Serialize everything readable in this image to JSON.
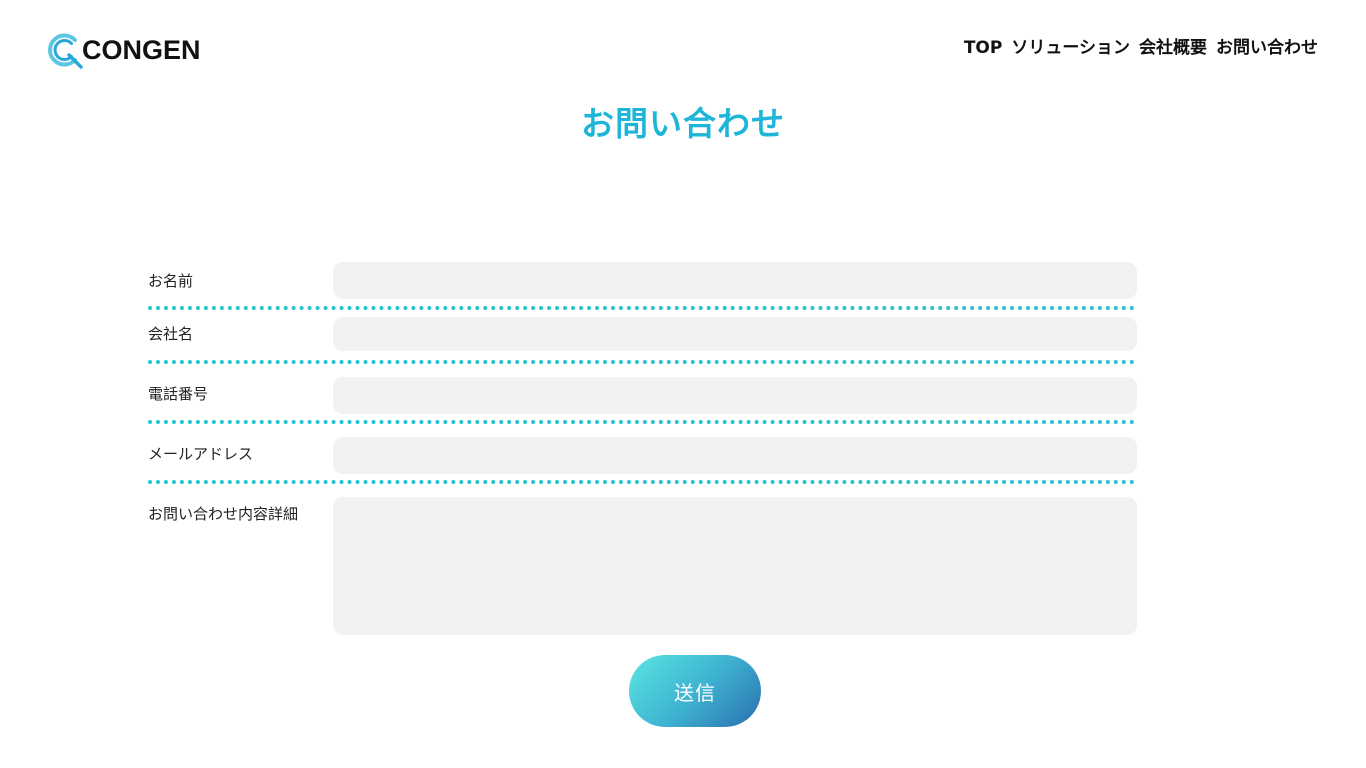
{
  "brand": {
    "logo_text": "CONGEN",
    "accent_color": "#1fb5d8"
  },
  "nav": {
    "items": [
      {
        "label": "TOP"
      },
      {
        "label": "ソリューション"
      },
      {
        "label": "会社概要"
      },
      {
        "label": "お問い合わせ"
      }
    ]
  },
  "page": {
    "title": "お問い合わせ"
  },
  "form": {
    "name_label": "お名前",
    "name_value": "",
    "company_label": "会社名",
    "company_value": "",
    "phone_label": "電話番号",
    "phone_value": "",
    "email_label": "メールアドレス",
    "email_value": "",
    "message_label": "お問い合わせ内容詳細",
    "message_value": "",
    "submit_label": "送信",
    "field_bg_color": "#f3f2f0",
    "divider_color": "#22c3d0"
  }
}
